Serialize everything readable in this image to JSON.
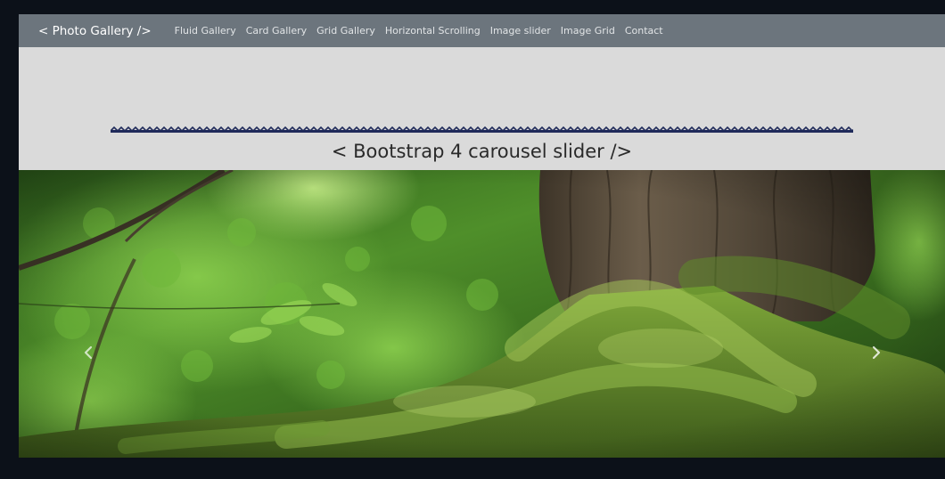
{
  "navbar": {
    "brand": "< Photo Gallery />",
    "links": [
      "Fluid Gallery",
      "Card Gallery",
      "Grid Gallery",
      "Horizontal Scrolling",
      "Image slider",
      "Image Grid",
      "Contact"
    ]
  },
  "section": {
    "title": "< Bootstrap 4 carousel slider />"
  },
  "carousel": {
    "prev_icon": "chevron-left-icon",
    "next_icon": "chevron-right-icon"
  },
  "colors": {
    "page_background": "#0c1119",
    "navbar_background": "#6c757d",
    "header_background": "#dadada",
    "wavy_rule": "#1f2a5a"
  }
}
